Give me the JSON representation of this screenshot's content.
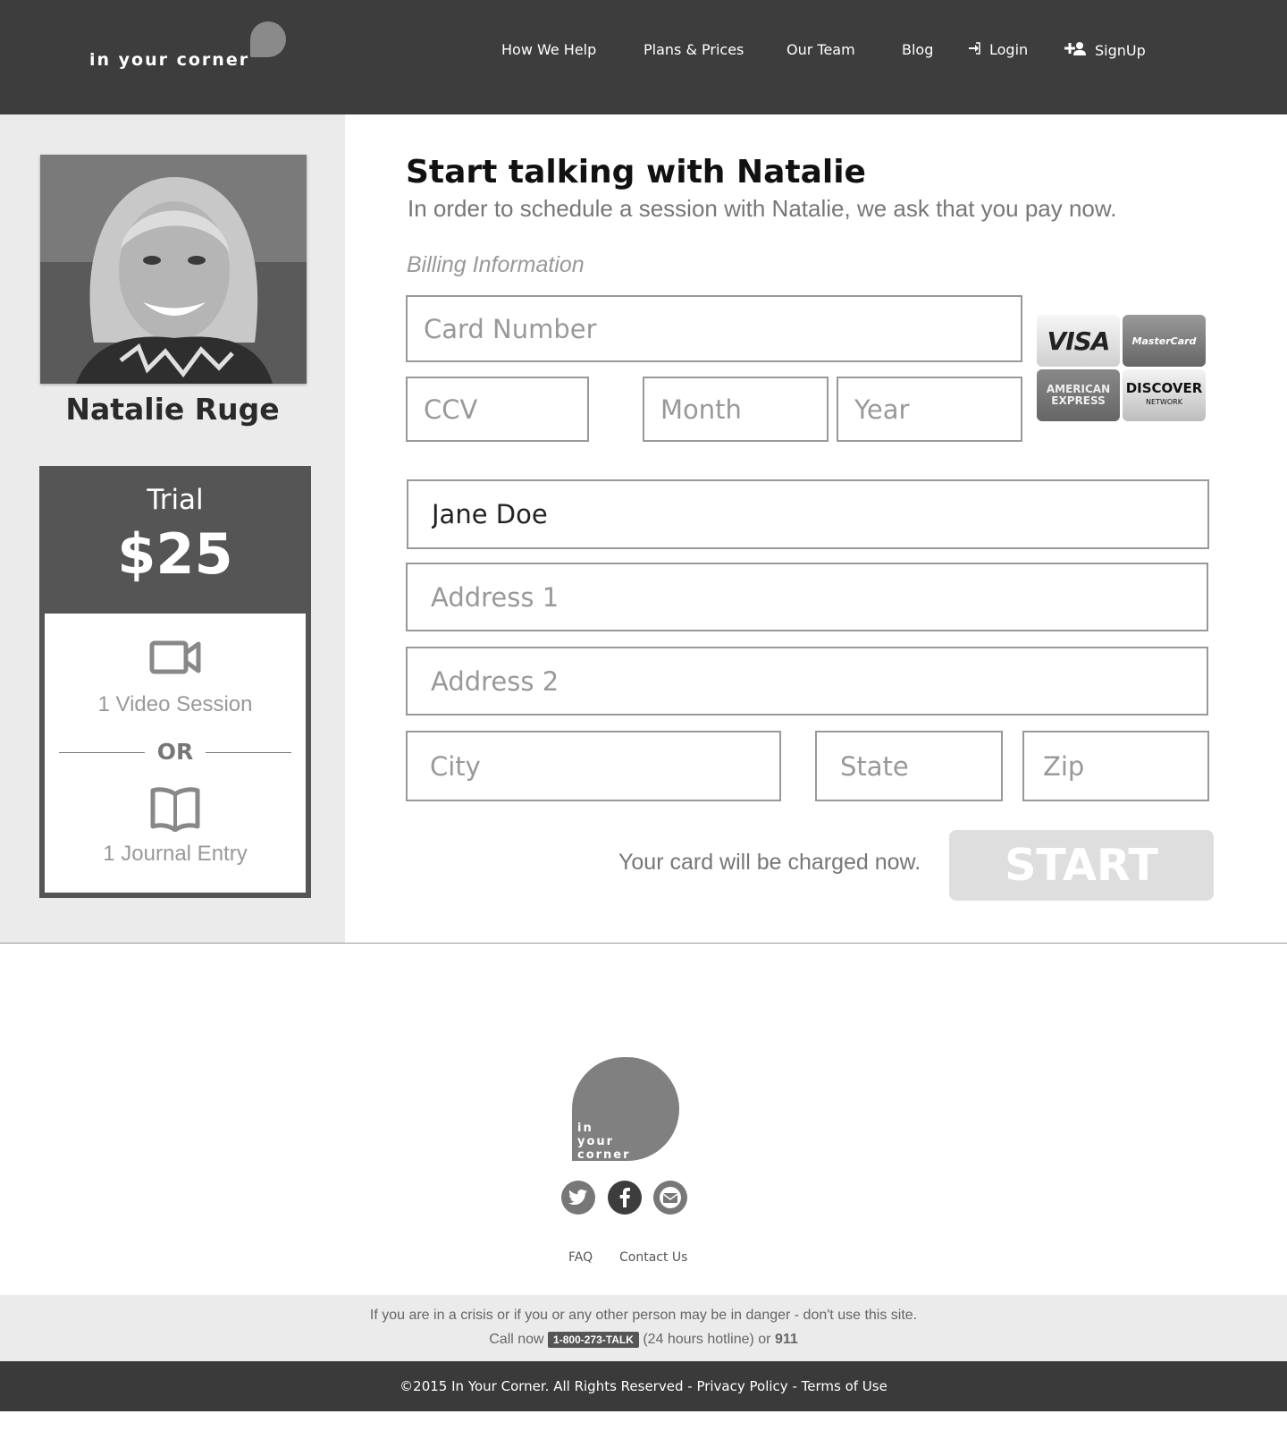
{
  "header": {
    "logo_text": "in your corner",
    "nav": {
      "how_we_help": "How We Help",
      "plans_prices": "Plans & Prices",
      "our_team": "Our Team",
      "blog": "Blog",
      "login": "Login",
      "signup": "SignUp"
    },
    "icons": {
      "login": "sign-in-icon",
      "signup": "user-plus-icon"
    }
  },
  "sidebar": {
    "therapist_name": "Natalie Ruge",
    "plan": {
      "name": "Trial",
      "price": "$25",
      "feature_1": "1 Video Session",
      "or_label": "OR",
      "feature_2": "1 Journal Entry",
      "icons": {
        "feature_1": "video-camera-icon",
        "feature_2": "book-icon"
      }
    }
  },
  "main": {
    "title": "Start talking with Natalie",
    "subtitle": "In order to schedule a session with Natalie, we ask that you pay now.",
    "billing_label": "Billing Information",
    "fields": {
      "card_number": {
        "placeholder": "Card Number",
        "value": ""
      },
      "ccv": {
        "placeholder": "CCV",
        "value": ""
      },
      "month": {
        "placeholder": "Month",
        "value": ""
      },
      "year": {
        "placeholder": "Year",
        "value": ""
      },
      "name": {
        "placeholder": "",
        "value": "Jane Doe"
      },
      "address1": {
        "placeholder": "Address 1",
        "value": ""
      },
      "address2": {
        "placeholder": "Address 2",
        "value": ""
      },
      "city": {
        "placeholder": "City",
        "value": ""
      },
      "state": {
        "placeholder": "State",
        "value": ""
      },
      "zip": {
        "placeholder": "Zip",
        "value": ""
      }
    },
    "cards": {
      "visa": "VISA",
      "mastercard": "MasterCard",
      "amex_line1": "AMERICAN",
      "amex_line2": "EXPRESS",
      "discover": "DISCOVER",
      "discover_sub": "NETWORK"
    },
    "charge_text": "Your card will be charged now.",
    "start_label": "START"
  },
  "footer": {
    "logo_line1": "in",
    "logo_line2": "your",
    "logo_line3": "corner",
    "social_icons": [
      "twitter-icon",
      "facebook-icon",
      "mail-icon"
    ],
    "links": {
      "faq": "FAQ",
      "contact": "Contact Us"
    },
    "crisis_line1": "If you are in a crisis or if you or any other person may be in danger - don't use this site.",
    "crisis_call_now": "Call now",
    "crisis_hotline": "1-800-273-TALK",
    "crisis_hours": "(24 hours hotline) or",
    "crisis_emergency": "911",
    "copyright": "©2015 In Your Corner. All Rights Reserved",
    "sep": " - ",
    "privacy": "Privacy Policy",
    "terms": "Terms of Use"
  },
  "colors": {
    "header_bg": "#3d3d3d",
    "sidebar_bg": "#ebebeb",
    "plan_bg": "#555555",
    "start_btn_bg": "#dedede",
    "footer_bar_bg": "#3a3a3a"
  }
}
